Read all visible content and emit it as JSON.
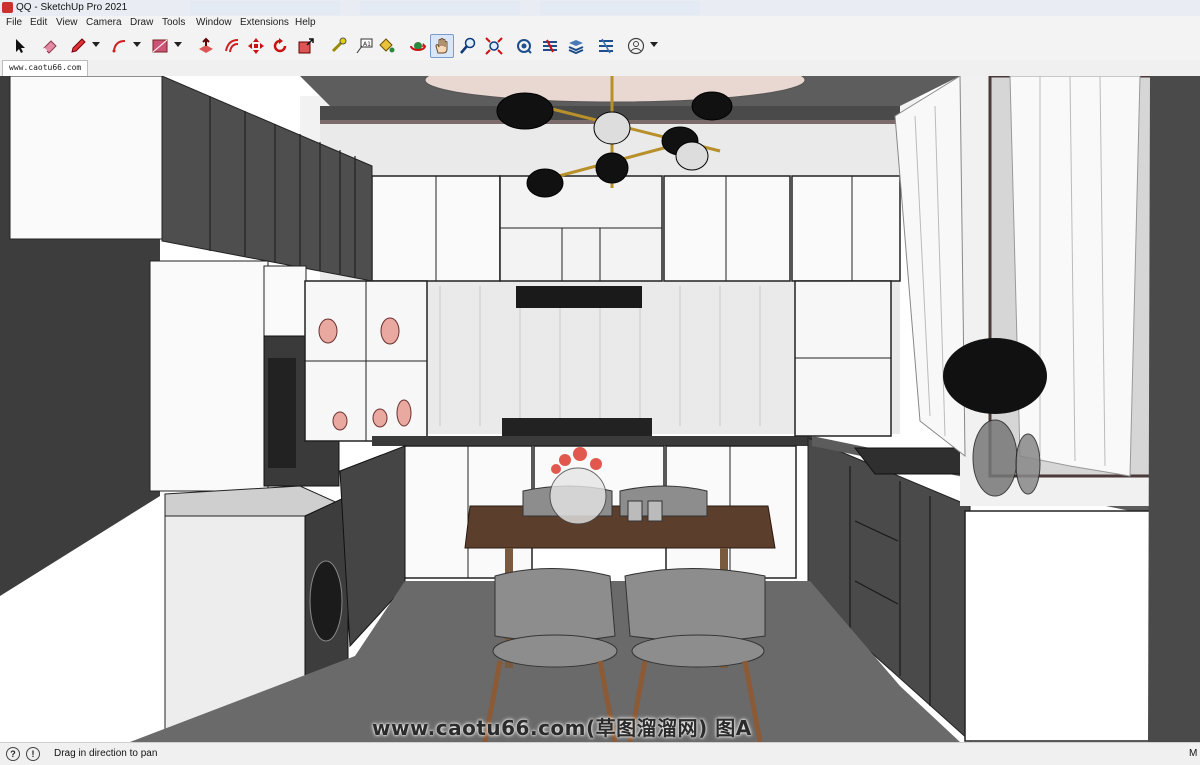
{
  "window": {
    "title": "QQ - SketchUp Pro 2021"
  },
  "menu": [
    "File",
    "Edit",
    "View",
    "Camera",
    "Draw",
    "Tools",
    "Window",
    "Extensions",
    "Help"
  ],
  "toolbar": {
    "tools": [
      "select-tool",
      "eraser-tool",
      "pencil-tool",
      "arc-tool",
      "shape-tool",
      "push-pull-tool",
      "move-tool",
      "offset-tool",
      "rotate-tool",
      "scale-tool",
      "tape-measure-tool",
      "text-tool",
      "paint-bucket-tool",
      "orbit-tool",
      "pan-tool",
      "zoom-tool",
      "zoom-extents-tool",
      "3d-warehouse",
      "extension-warehouse",
      "layout-send",
      "extension-manager",
      "account-menu"
    ],
    "active_tool": "pan-tool",
    "accent_color": "#7a9cc9"
  },
  "scene_tab": {
    "label": "www.caotu66.com"
  },
  "viewport": {
    "watermark": "www.caotu66.com(草图溜溜网) 图A"
  },
  "status": {
    "hint": "Drag in direction to pan",
    "right_text": "M"
  }
}
